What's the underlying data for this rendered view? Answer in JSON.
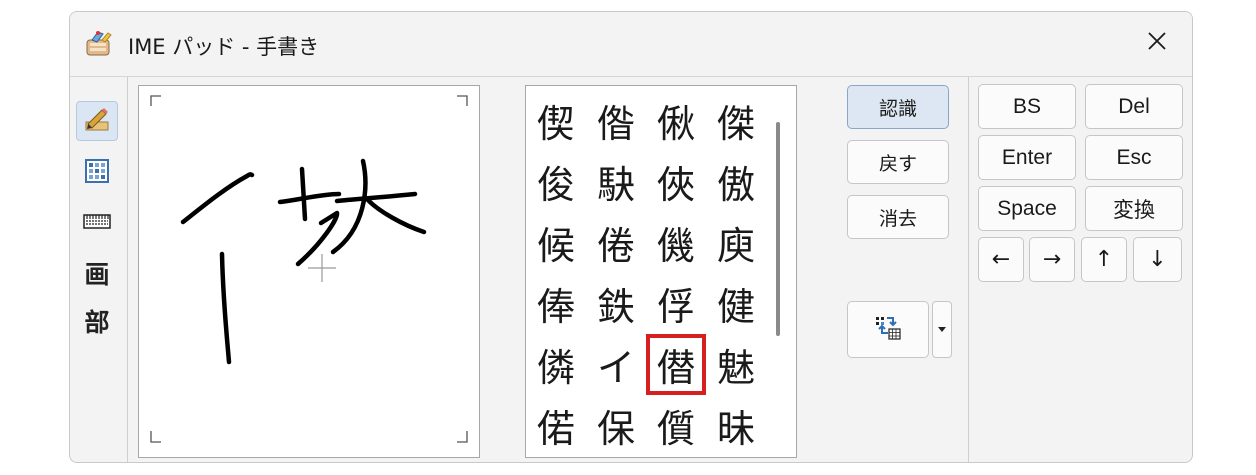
{
  "window": {
    "title": "IME パッド - 手書き"
  },
  "icons": {
    "app": "ime-pad-app-icon",
    "close": "close-icon"
  },
  "toolbar": {
    "items": [
      {
        "name": "handwriting-mode",
        "icon": "pen-icon",
        "glyph": ""
      },
      {
        "name": "character-list-mode",
        "icon": "character-list-icon",
        "glyph": ""
      },
      {
        "name": "soft-keyboard-mode",
        "icon": "keyboard-icon",
        "glyph": ""
      },
      {
        "name": "stroke-count-mode",
        "glyph": "画"
      },
      {
        "name": "radical-mode",
        "glyph": "部"
      }
    ]
  },
  "candidates": {
    "rows": [
      [
        "偰",
        "偺",
        "偢",
        "傑"
      ],
      [
        "俊",
        "駃",
        "俠",
        "傲"
      ],
      [
        "候",
        "倦",
        "僟",
        "庾"
      ],
      [
        "俸",
        "鉄",
        "俘",
        "健"
      ],
      [
        "僯",
        "イ",
        "僣",
        "魅"
      ],
      [
        "偌",
        "保",
        "儨",
        "昧"
      ]
    ],
    "selected": {
      "row": 4,
      "col": 2
    },
    "highlight_color": "#d62020"
  },
  "actions": {
    "recognize": "認識",
    "undo": "戻す",
    "clear": "消去"
  },
  "keys": {
    "bs": "BS",
    "del": "Del",
    "enter": "Enter",
    "esc": "Esc",
    "space": "Space",
    "convert": "変換",
    "left": "←",
    "right": "→",
    "up": "↑",
    "down": "↓"
  },
  "colors": {
    "accent": "#dde7f3",
    "ink": "#000000"
  }
}
